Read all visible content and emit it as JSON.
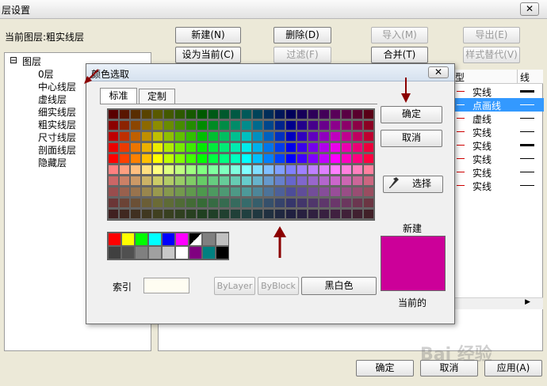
{
  "window": {
    "title": "层设置",
    "close_icon": "close-icon",
    "current_layer_label": "当前图层:粗实线层"
  },
  "toolbar": {
    "new": "新建(N)",
    "delete": "删除(D)",
    "import": "导入(M)",
    "export": "导出(E)",
    "set_current": "设为当前(C)",
    "filter": "过滤(F)",
    "merge": "合并(T)",
    "style_replace": "样式替代(V)"
  },
  "tree": {
    "root_toggle": "⊟",
    "root": "图层",
    "items": [
      "0层",
      "中心线层",
      "虚线层",
      "细实线层",
      "粗实线层",
      "尺寸线层",
      "剖面线层",
      "隐藏层"
    ]
  },
  "table": {
    "headers": [
      "型",
      "线"
    ],
    "rows": [
      {
        "type": "实线",
        "selected": false
      },
      {
        "type": "点画线",
        "selected": true
      },
      {
        "type": "虚线",
        "selected": false
      },
      {
        "type": "实线",
        "selected": false
      },
      {
        "type": "实线",
        "selected": false
      },
      {
        "type": "实线",
        "selected": false
      },
      {
        "type": "实线",
        "selected": false
      },
      {
        "type": "实线",
        "selected": false
      }
    ]
  },
  "bottom": {
    "ok": "确定",
    "cancel": "取消",
    "apply": "应用(A)"
  },
  "dialog": {
    "title": "颜色选取",
    "close_icon": "close-icon",
    "tabs": [
      "标准",
      "定制"
    ],
    "ok": "确定",
    "cancel": "取消",
    "pick_label": "选择",
    "pick_icon": "eyedropper-icon",
    "index_label": "索引",
    "index_value": "",
    "bylayer": "ByLayer",
    "byblock": "ByBlock",
    "black_white": "黑白色",
    "new_label": "新建",
    "current_label": "当前的",
    "preview_color": "#cc0099"
  },
  "watermark": "Bai 经验"
}
